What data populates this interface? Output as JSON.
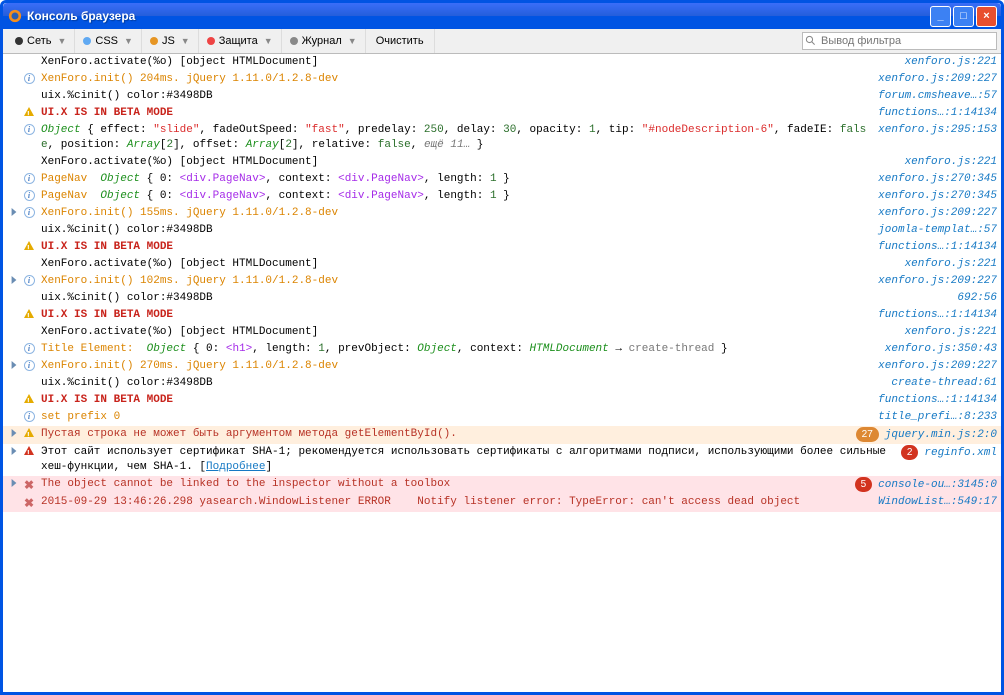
{
  "titlebar": {
    "title": "Консоль браузера"
  },
  "toolbar": {
    "net": "Сеть",
    "css": "CSS",
    "js": "JS",
    "security": "Защита",
    "log": "Журнал",
    "clear": "Очистить",
    "search_placeholder": "Вывод фильтра"
  },
  "rows": [
    {
      "lvl": "",
      "msg_plain": "XenForo.activate(%o) [object HTMLDocument]",
      "src": "xenforo.js:221"
    },
    {
      "lvl": "info",
      "msg_html": "<span class='c-orange'>XenForo.init() 204ms. jQuery 1.11.0/1.2.8-dev</span>",
      "src": "xenforo.js:209:227"
    },
    {
      "lvl": "",
      "msg_plain": "uix.%cinit() color:#3498DB",
      "src": "forum.cmsheave…:57"
    },
    {
      "lvl": "warn",
      "msg_html": "<span class='c-red'>UI.X IS IN BETA MODE</span>",
      "src": "functions…:1:14134"
    },
    {
      "lvl": "info",
      "msg_html": "<span class='c-obj c-ital'>Object</span> { effect: <span class='c-str'>\"slide\"</span>, fadeOutSpeed: <span class='c-str'>\"fast\"</span>, predelay: <span class='c-num'>250</span>, delay: <span class='c-num'>30</span>, opacity: <span class='c-num'>1</span>, tip: <span class='c-str'>\"#nodeDescription-6\"</span>, fadeIE: <span class='c-bool'>false</span>, position: <span class='c-obj c-ital'>Array</span>[<span class='c-num'>2</span>], offset: <span class='c-obj c-ital'>Array</span>[<span class='c-num'>2</span>], relative: <span class='c-bool'>false</span>, <span class='c-gray c-ital'>ещё 11…</span> }",
      "src": "xenforo.js:295:153"
    },
    {
      "lvl": "",
      "msg_plain": "XenForo.activate(%o) [object HTMLDocument]",
      "src": "xenforo.js:221"
    },
    {
      "lvl": "info",
      "msg_html": "<span class='c-orange'>PageNav</span>&nbsp;&nbsp;<span class='c-obj c-ital'>Object</span> { 0: <span class='c-tag'>&lt;div.PageNav&gt;</span>, context: <span class='c-tag'>&lt;div.PageNav&gt;</span>, length: <span class='c-num'>1</span> }",
      "src": "xenforo.js:270:345"
    },
    {
      "lvl": "info",
      "msg_html": "<span class='c-orange'>PageNav</span>&nbsp;&nbsp;<span class='c-obj c-ital'>Object</span> { 0: <span class='c-tag'>&lt;div.PageNav&gt;</span>, context: <span class='c-tag'>&lt;div.PageNav&gt;</span>, length: <span class='c-num'>1</span> }",
      "src": "xenforo.js:270:345"
    },
    {
      "lvl": "info",
      "wrap": true,
      "msg_html": "<span class='c-orange'>XenForo.init() 155ms. jQuery 1.11.0/1.2.8-dev</span>",
      "src": "xenforo.js:209:227"
    },
    {
      "lvl": "",
      "msg_plain": "uix.%cinit() color:#3498DB",
      "src": "joomla-templat…:57"
    },
    {
      "lvl": "warn",
      "msg_html": "<span class='c-red'>UI.X IS IN BETA MODE</span>",
      "src": "functions…:1:14134"
    },
    {
      "lvl": "",
      "msg_plain": "XenForo.activate(%o) [object HTMLDocument]",
      "src": "xenforo.js:221"
    },
    {
      "lvl": "info",
      "wrap": true,
      "msg_html": "<span class='c-orange'>XenForo.init() 102ms. jQuery 1.11.0/1.2.8-dev</span>",
      "src": "xenforo.js:209:227"
    },
    {
      "lvl": "",
      "msg_plain": "uix.%cinit() color:#3498DB",
      "src": "692:56"
    },
    {
      "lvl": "warn",
      "msg_html": "<span class='c-red'>UI.X IS IN BETA MODE</span>",
      "src": "functions…:1:14134"
    },
    {
      "lvl": "",
      "msg_plain": "XenForo.activate(%o) [object HTMLDocument]",
      "src": "xenforo.js:221"
    },
    {
      "lvl": "info",
      "msg_html": "<span class='c-orange'>Title Element:</span>&nbsp;&nbsp;<span class='c-obj c-ital'>Object</span> { 0: <span class='c-tag'>&lt;h1&gt;</span>, length: <span class='c-num'>1</span>, prevObject: <span class='c-obj c-ital'>Object</span>, context: <span class='c-obj c-ital'>HTMLDocument</span> → <span class='c-gray'>create-thread</span> }",
      "src": "xenforo.js:350:43"
    },
    {
      "lvl": "info",
      "wrap": true,
      "msg_html": "<span class='c-orange'>XenForo.init() 270ms. jQuery 1.11.0/1.2.8-dev</span>",
      "src": "xenforo.js:209:227"
    },
    {
      "lvl": "",
      "msg_plain": "uix.%cinit() color:#3498DB",
      "src": "create-thread:61"
    },
    {
      "lvl": "warn",
      "msg_html": "<span class='c-red'>UI.X IS IN BETA MODE</span>",
      "src": "functions…:1:14134"
    },
    {
      "lvl": "info",
      "msg_html": "<span class='c-orange'>set prefix 0</span>",
      "src": "title_prefi…:8:233"
    },
    {
      "lvl": "warn",
      "wrap": true,
      "bg": "warn-bg",
      "msg_html": "<span class='c-darkred'>Пустая строка не может быть аргументом метода getElementById().</span>",
      "badge": "27",
      "badgeClass": "",
      "src": "jquery.min.js:2:0"
    },
    {
      "lvl": "err",
      "wrap": true,
      "bg": "",
      "msg_html": "<span>Этот сайт использует сертификат SHA-1; рекомендуется использовать сертификаты с алгоритмами подписи, использующими более сильные хеш-функции, чем SHA-1. [<a class='link' href='#'>Подробнее</a>]</span>",
      "badge": "2",
      "badgeClass": "red",
      "src": "reginfo.xml"
    },
    {
      "lvl": "x",
      "wrap": true,
      "bg": "err-bg",
      "msg_html": "<span class='c-darkred'>The object cannot be linked to the inspector without a toolbox</span>",
      "badge": "5",
      "badgeClass": "red",
      "src": "console-ou…:3145:0"
    },
    {
      "lvl": "x",
      "bg": "err-bg",
      "msg_html": "<span class='c-darkred'>2015-09-29 13:46:26.298 yasearch.WindowListener ERROR&nbsp;&nbsp;&nbsp;&nbsp;Notify listener error: TypeError: can't access dead object</span>",
      "src": "WindowList…:549:17"
    }
  ]
}
